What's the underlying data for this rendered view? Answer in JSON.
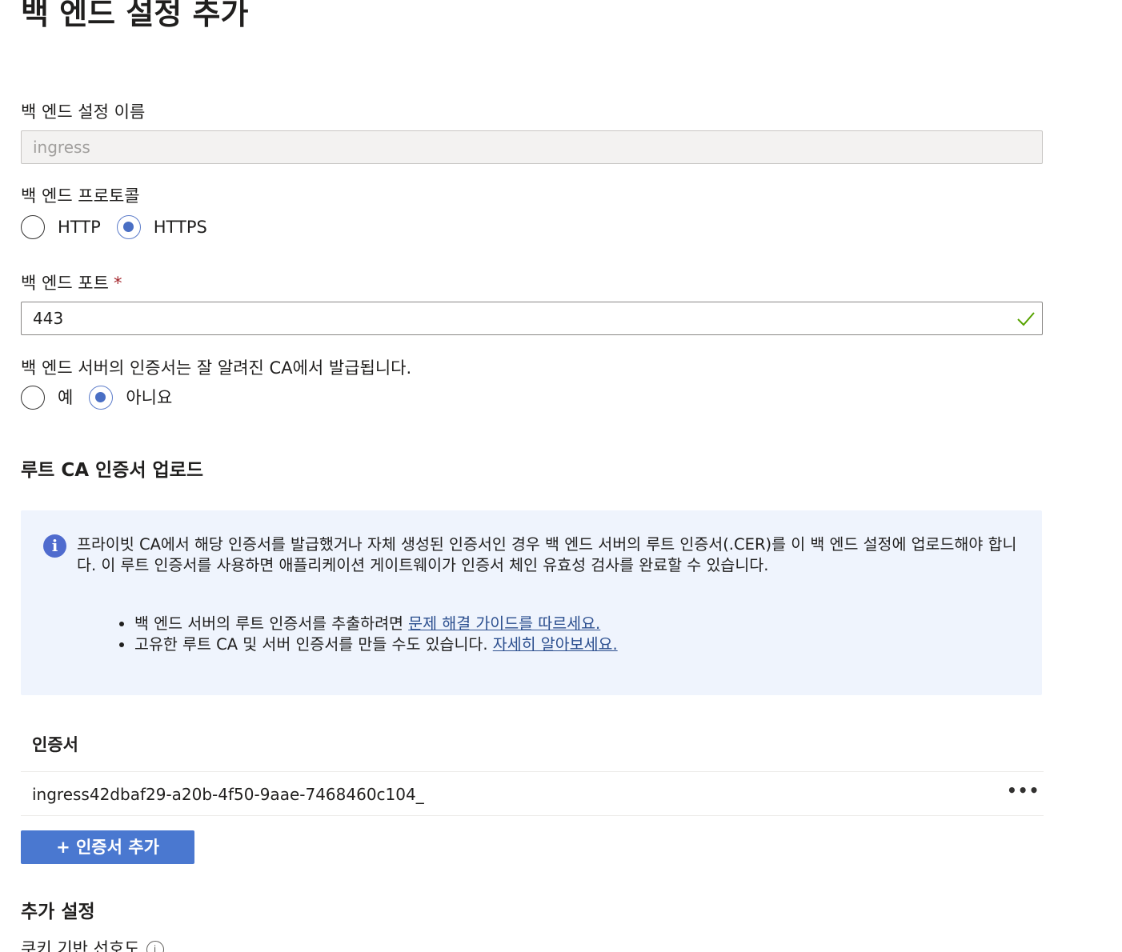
{
  "page": {
    "title": "백 엔드 설정 추가"
  },
  "name_field": {
    "label": "백 엔드 설정 이름",
    "value": "ingress"
  },
  "protocol": {
    "label": "백 엔드 프로토콜",
    "options": [
      "HTTP",
      "HTTPS"
    ],
    "selected": "HTTPS"
  },
  "port_field": {
    "label": "백 엔드 포트",
    "required_marker": "*",
    "value": "443",
    "valid_icon": "checkmark-icon",
    "valid_color": "#57a300"
  },
  "well_known_ca": {
    "label": "백 엔드 서버의 인증서는 잘 알려진 CA에서 발급됩니다.",
    "options": [
      "예",
      "아니요"
    ],
    "selected": "아니요"
  },
  "root_ca_section": {
    "heading": "루트 CA 인증서 업로드"
  },
  "info_box": {
    "icon": "info-icon",
    "text": "프라이빗 CA에서 해당 인증서를 발급했거나 자체 생성된 인증서인 경우 백 엔드 서버의 루트 인증서(.CER)를 이 백 엔드 설정에 업로드해야 합니다. 이 루트 인증서를 사용하면 애플리케이션 게이트웨이가 인증서 체인 유효성 검사를 완료할 수 있습니다.",
    "bullets": [
      {
        "text": "백 엔드 서버의 루트 인증서를 추출하려면 ",
        "link": "문제 해결 가이드를 따르세요."
      },
      {
        "text": "고유한 루트 CA 및 서버 인증서를 만들 수도 있습니다. ",
        "link": "자세히 알아보세요."
      }
    ],
    "background": "#eff4fd"
  },
  "certificates": {
    "column_header": "인증서",
    "rows": [
      {
        "name": "ingress42dbaf29-a20b-4f50-9aae-7468460c104_",
        "more_label": "•••"
      }
    ],
    "add_button_label": "+ 인증서 추가",
    "accent": "#4a78d0"
  },
  "additional_settings": {
    "heading": "추가 설정",
    "next_label": "쿠키 기반 선호도"
  }
}
